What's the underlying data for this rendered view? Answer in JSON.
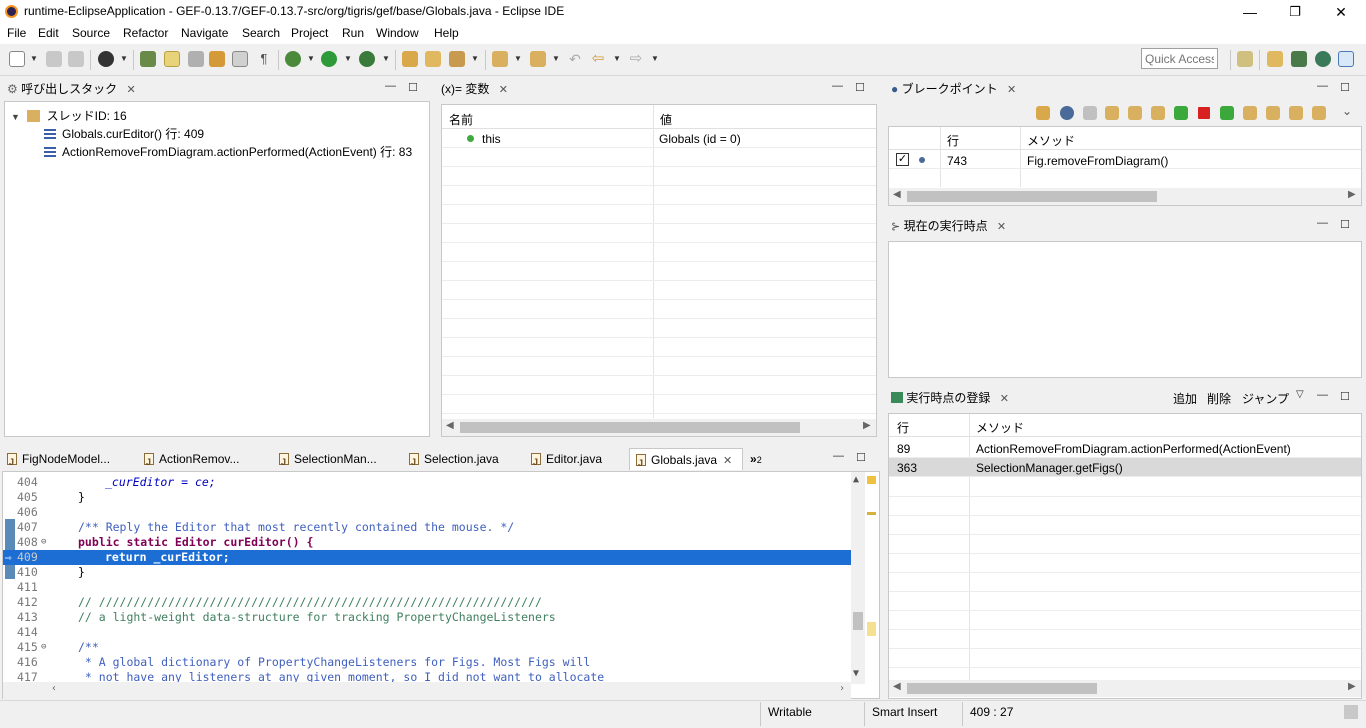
{
  "window": {
    "title": "runtime-EclipseApplication - GEF-0.13.7/GEF-0.13.7-src/org/tigris/gef/base/Globals.java - Eclipse IDE",
    "minimize": "—",
    "restore": "❐",
    "close": "✕"
  },
  "menu": [
    "File",
    "Edit",
    "Source",
    "Refactor",
    "Navigate",
    "Search",
    "Project",
    "Run",
    "Window",
    "Help"
  ],
  "toolbar": {
    "quick_access_placeholder": "Quick Access"
  },
  "callstack": {
    "tab": "呼び出しスタック",
    "thread": "スレッドID: 16",
    "frames": [
      "Globals.curEditor() 行: 409",
      "ActionRemoveFromDiagram.actionPerformed(ActionEvent) 行: 83"
    ]
  },
  "variables": {
    "tab": "(x)= 変数",
    "col_name": "名前",
    "col_value": "値",
    "rows": [
      {
        "name": "this",
        "value": "Globals (id = 0)"
      }
    ]
  },
  "breakpoints": {
    "tab": "ブレークポイント",
    "col_line": "行",
    "col_method": "メソッド",
    "rows": [
      {
        "line": "743",
        "method": "Fig.removeFromDiagram()"
      }
    ]
  },
  "current_exec": {
    "tab": "現在の実行時点"
  },
  "exec_points": {
    "tab": "実行時点の登録",
    "add": "追加",
    "delete": "削除",
    "jump": "ジャンプ",
    "col_line": "行",
    "col_method": "メソッド",
    "rows": [
      {
        "line": "89",
        "method": "ActionRemoveFromDiagram.actionPerformed(ActionEvent)"
      },
      {
        "line": "363",
        "method": "SelectionManager.getFigs()"
      }
    ]
  },
  "editor": {
    "tabs": [
      "FigNodeModel...",
      "ActionRemov...",
      "SelectionMan...",
      "Selection.java",
      "Editor.java",
      "Globals.java"
    ],
    "overflow": "»",
    "overflow_count": "2",
    "lines": [
      {
        "n": "404",
        "text": "_curEditor = ce;"
      },
      {
        "n": "405",
        "text": "}"
      },
      {
        "n": "406",
        "text": ""
      },
      {
        "n": "407",
        "text": "/** Reply the Editor that most recently contained the mouse. */"
      },
      {
        "n": "408",
        "text": "public static Editor curEditor() {"
      },
      {
        "n": "409",
        "text": "return _curEditor;"
      },
      {
        "n": "410",
        "text": "}"
      },
      {
        "n": "411",
        "text": ""
      },
      {
        "n": "412",
        "text": "// ////////////////////////////////////////////////////////////////"
      },
      {
        "n": "413",
        "text": "// a light-weight data-structure for tracking PropertyChangeListeners"
      },
      {
        "n": "414",
        "text": ""
      },
      {
        "n": "415",
        "text": "/**"
      },
      {
        "n": "416",
        "text": " * A global dictionary of PropertyChangeListeners for Figs. Most Figs will"
      },
      {
        "n": "417",
        "text": " * not have any listeners at any given moment, so I did not want to allocate"
      }
    ]
  },
  "status": {
    "writable": "Writable",
    "insert": "Smart Insert",
    "position": "409 : 27"
  }
}
